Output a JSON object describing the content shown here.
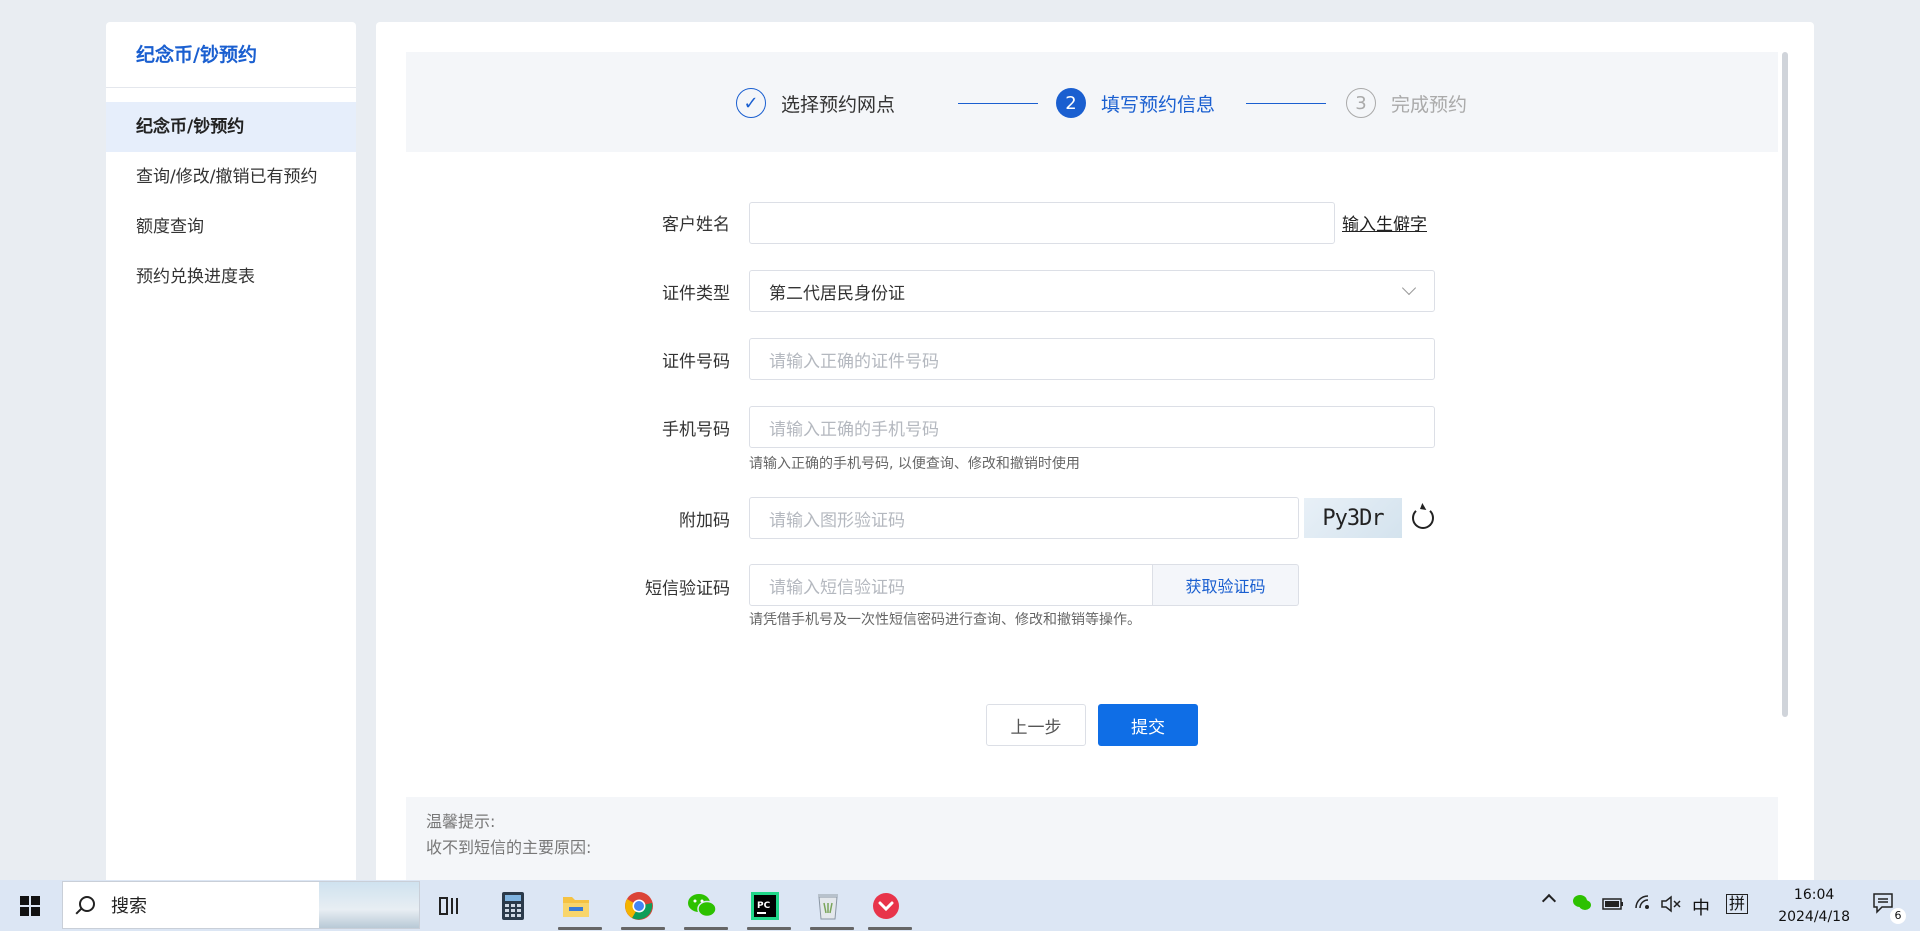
{
  "sidebar": {
    "title": "纪念币/钞预约",
    "items": [
      {
        "label": "纪念币/钞预约",
        "active": true
      },
      {
        "label": "查询/修改/撤销已有预约",
        "active": false
      },
      {
        "label": "额度查询",
        "active": false
      },
      {
        "label": "预约兑换进度表",
        "active": false
      }
    ]
  },
  "steps": [
    {
      "index": "✓",
      "label": "选择预约网点",
      "state": "done"
    },
    {
      "index": "2",
      "label": "填写预约信息",
      "state": "current"
    },
    {
      "index": "3",
      "label": "完成预约",
      "state": "pending"
    }
  ],
  "form": {
    "name": {
      "label": "客户姓名",
      "value": "",
      "link": "输入生僻字"
    },
    "id_type": {
      "label": "证件类型",
      "value": "第二代居民身份证"
    },
    "id_number": {
      "label": "证件号码",
      "placeholder": "请输入正确的证件号码"
    },
    "phone": {
      "label": "手机号码",
      "placeholder": "请输入正确的手机号码",
      "helper": "请输入正确的手机号码, 以便查询、修改和撤销时使用"
    },
    "captcha": {
      "label": "附加码",
      "placeholder": "请输入图形验证码",
      "image_text": "Py3Dr"
    },
    "sms": {
      "label": "短信验证码",
      "placeholder": "请输入短信验证码",
      "button": "获取验证码",
      "helper": "请凭借手机号及一次性短信密码进行查询、修改和撤销等操作。"
    }
  },
  "buttons": {
    "prev": "上一步",
    "submit": "提交"
  },
  "tips": {
    "title": "温馨提示:",
    "line1": "收不到短信的主要原因:"
  },
  "taskbar": {
    "search_label": "搜索",
    "tray": {
      "ime_lang": "中",
      "ime_mode": "拼",
      "time": "16:04",
      "date": "2024/4/18",
      "notifications": "6"
    }
  },
  "colors": {
    "accent": "#1a5fd0",
    "submit": "#0f6ee6",
    "background": "#e9edf2"
  }
}
